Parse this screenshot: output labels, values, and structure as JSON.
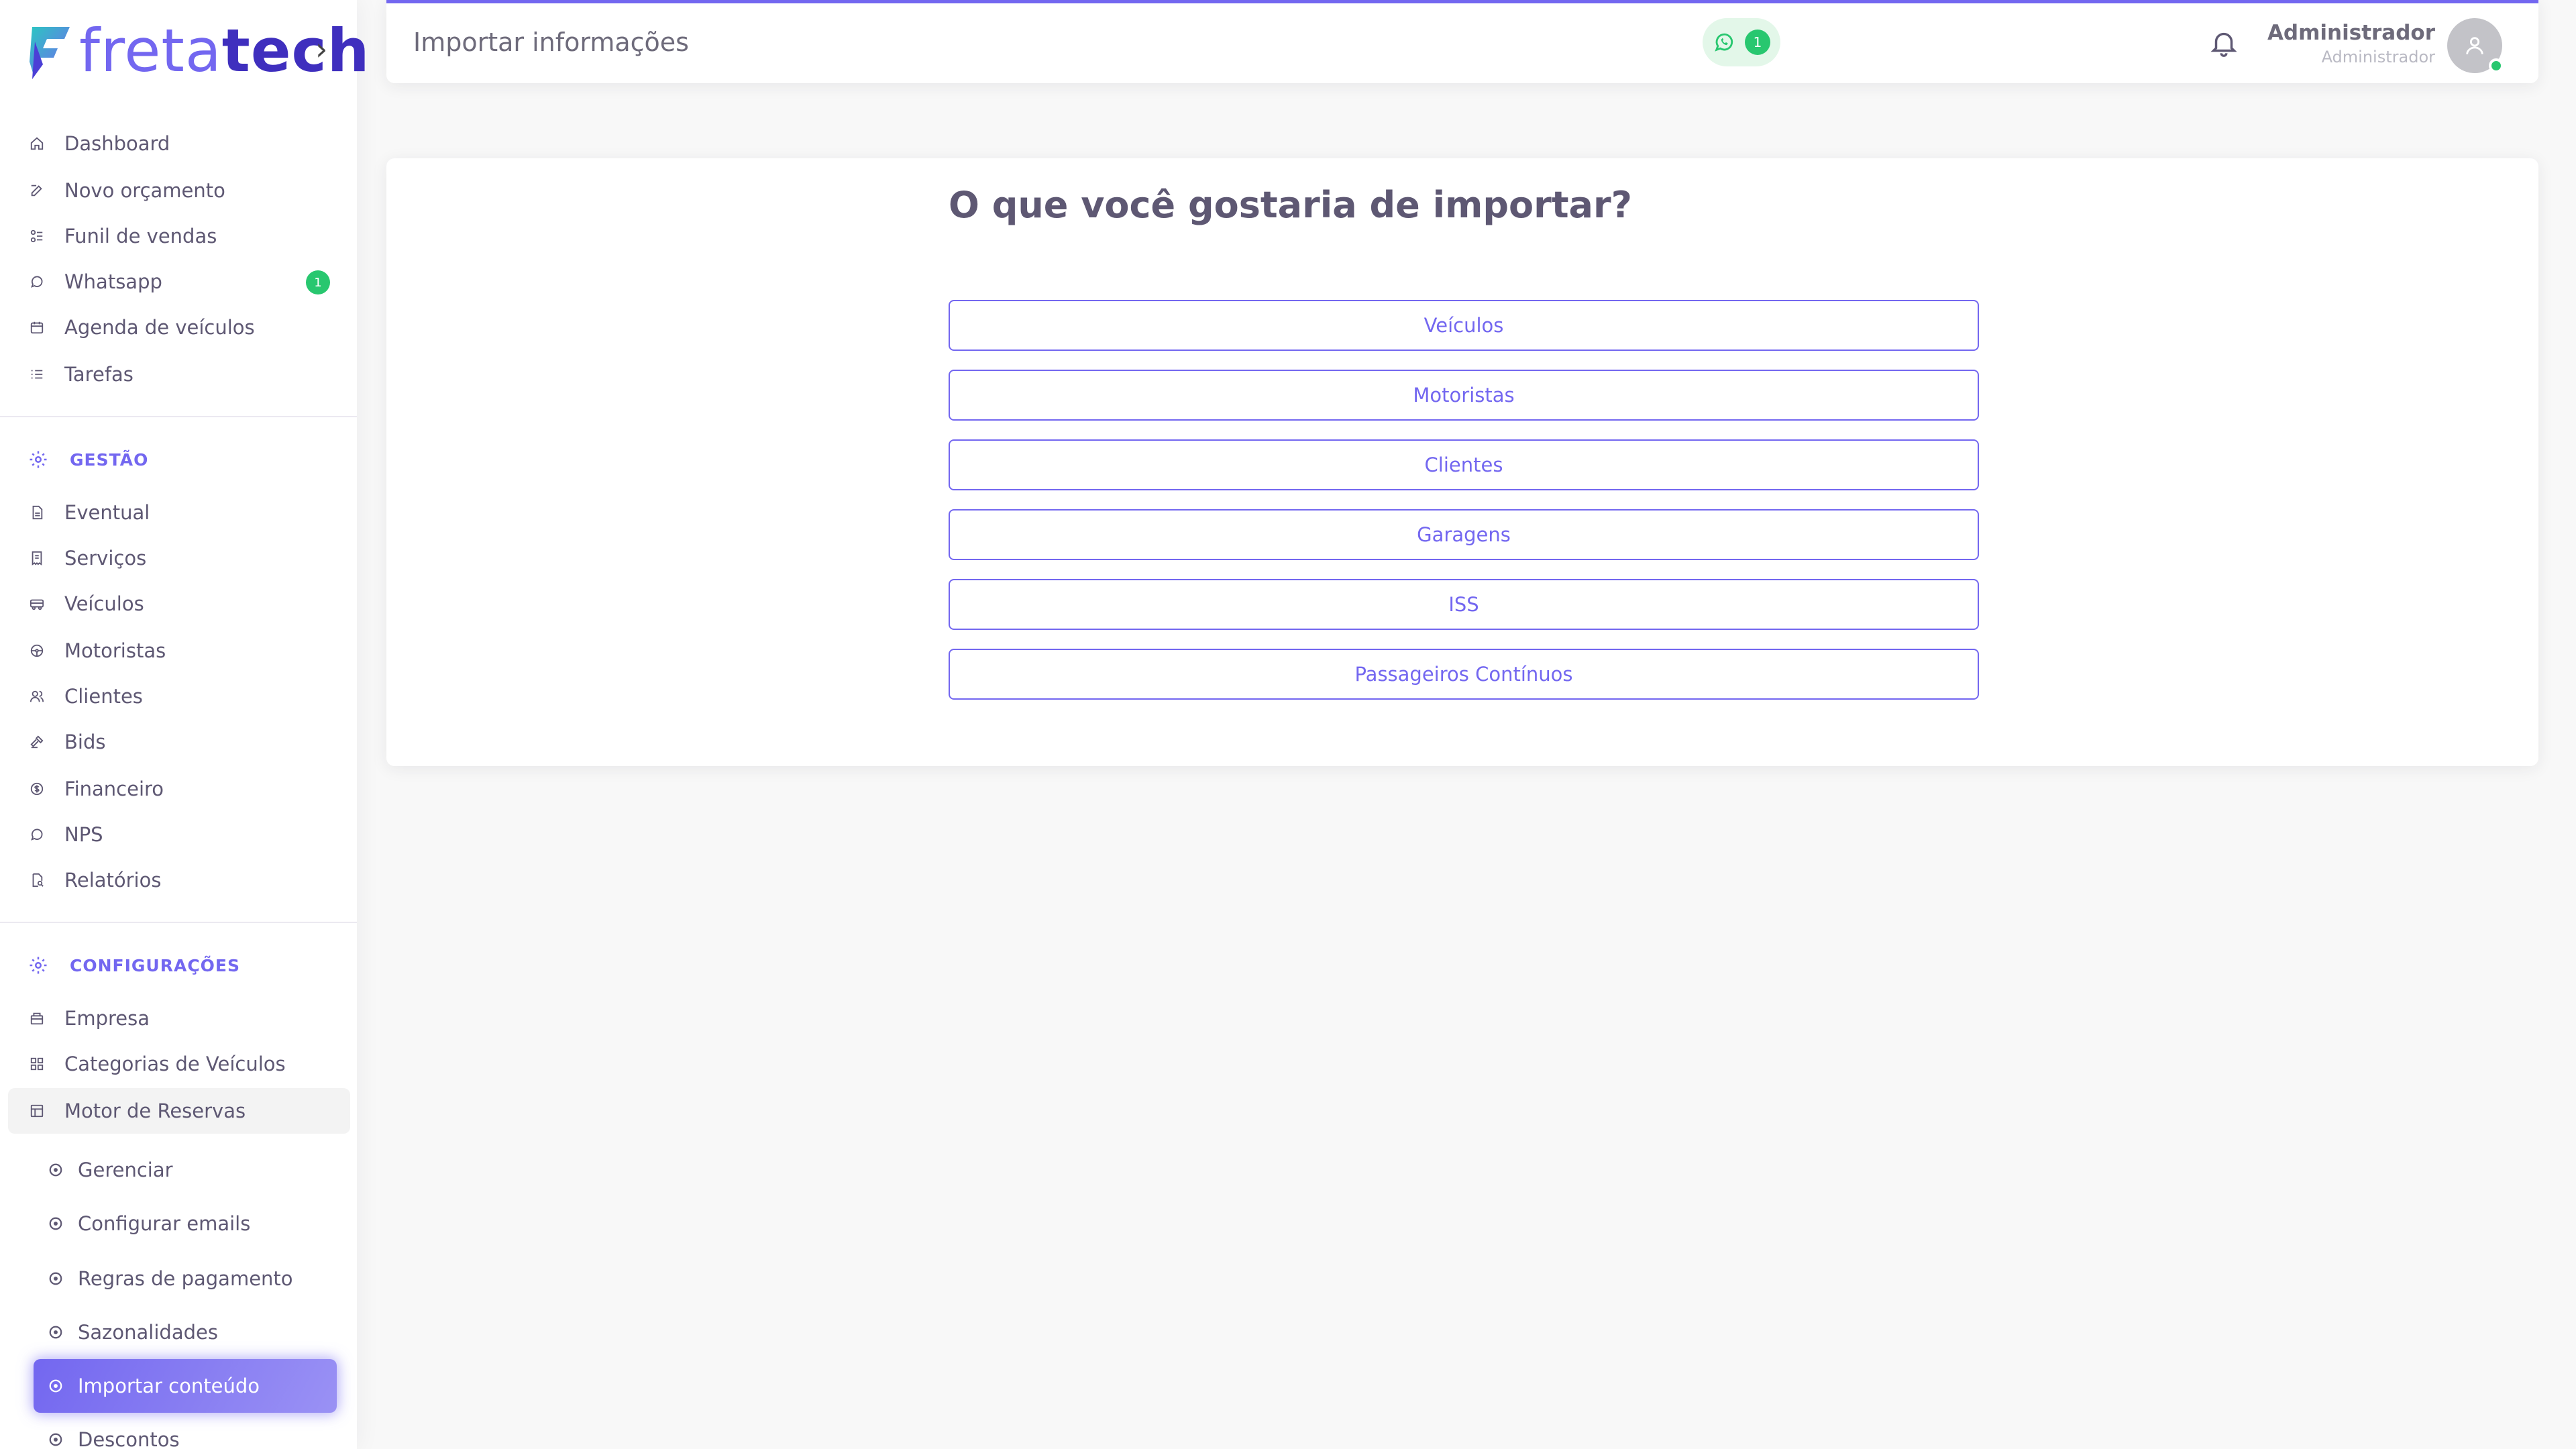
{
  "brand": {
    "name_part1": "freta",
    "name_part2": "tech",
    "colors": {
      "primary": "#7367f0",
      "dark": "#3f2fbe",
      "success": "#28c76f"
    }
  },
  "sidebar": {
    "main_items": [
      {
        "label": "Dashboard",
        "icon": "home-icon"
      },
      {
        "label": "Novo orçamento",
        "icon": "edit-icon"
      },
      {
        "label": "Funil de vendas",
        "icon": "funnel-icon"
      },
      {
        "label": "Whatsapp",
        "icon": "whatsapp-icon",
        "badge": "1"
      },
      {
        "label": "Agenda de veículos",
        "icon": "calendar-icon"
      },
      {
        "label": "Tarefas",
        "icon": "list-icon"
      }
    ],
    "section_gestao": "GESTÃO",
    "gestao_items": [
      {
        "label": "Eventual",
        "icon": "file-icon"
      },
      {
        "label": "Serviços",
        "icon": "receipt-icon"
      },
      {
        "label": "Veículos",
        "icon": "bus-icon"
      },
      {
        "label": "Motoristas",
        "icon": "steering-wheel-icon"
      },
      {
        "label": "Clientes",
        "icon": "users-icon"
      },
      {
        "label": "Bids",
        "icon": "gavel-icon"
      },
      {
        "label": "Financeiro",
        "icon": "coin-icon"
      },
      {
        "label": "NPS",
        "icon": "chat-icon"
      },
      {
        "label": "Relatórios",
        "icon": "report-icon"
      }
    ],
    "section_config": "CONFIGURAÇÕES",
    "config_items": [
      {
        "label": "Empresa",
        "icon": "building-icon"
      },
      {
        "label": "Categorias de Veículos",
        "icon": "grid-icon"
      },
      {
        "label": "Motor de Reservas",
        "icon": "table-icon"
      }
    ],
    "sub_items": [
      {
        "label": "Gerenciar"
      },
      {
        "label": "Configurar emails"
      },
      {
        "label": "Regras de pagamento"
      },
      {
        "label": "Sazonalidades"
      },
      {
        "label": "Importar conteúdo"
      },
      {
        "label": "Descontos"
      }
    ]
  },
  "header": {
    "title": "Importar informações",
    "whatsapp_count": "1",
    "user_name": "Administrador",
    "user_role": "Administrador"
  },
  "main": {
    "question": "O que você gostaria de importar?",
    "options": [
      "Veículos",
      "Motoristas",
      "Clientes",
      "Garagens",
      "ISS",
      "Passageiros Contínuos"
    ]
  }
}
